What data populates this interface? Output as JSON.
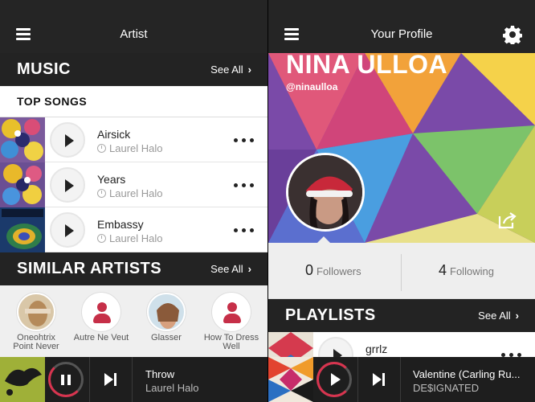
{
  "left_screen": {
    "header_title": "Artist",
    "music": {
      "title": "MUSIC",
      "see_all": "See All"
    },
    "top_songs_label": "TOP SONGS",
    "songs": [
      {
        "title": "Airsick",
        "artist": "Laurel Halo"
      },
      {
        "title": "Years",
        "artist": "Laurel Halo"
      },
      {
        "title": "Embassy",
        "artist": "Laurel Halo"
      }
    ],
    "similar": {
      "title": "SIMILAR ARTISTS",
      "see_all": "See All",
      "artists": [
        {
          "name_line1": "Oneohtrix",
          "name_line2": "Point Never"
        },
        {
          "name_line1": "Autre Ne Veut",
          "name_line2": ""
        },
        {
          "name_line1": "Glasser",
          "name_line2": ""
        },
        {
          "name_line1": "How To Dress",
          "name_line2": "Well"
        }
      ]
    },
    "player": {
      "title": "Throw",
      "artist": "Laurel Halo",
      "progress_fraction": 0.35
    }
  },
  "right_screen": {
    "header_title": "Your Profile",
    "profile_name": "NINA ULLOA",
    "handle": "@ninaulloa",
    "followers": {
      "count": "0",
      "label": "Followers"
    },
    "following": {
      "count": "4",
      "label": "Following"
    },
    "playlists": {
      "title": "PLAYLISTS",
      "see_all": "See All"
    },
    "playlist_items": [
      {
        "title": "grrlz"
      }
    ],
    "player": {
      "title": "Valentine (Carling Ru...",
      "artist": "DE$IGNATED",
      "progress_fraction": 0.6
    }
  },
  "colors": {
    "accent": "#d8344f",
    "bar": "#232323"
  },
  "icons": [
    "menu-icon",
    "chevron-right-icon",
    "play-icon",
    "clock-icon",
    "more-icon",
    "pause-icon",
    "skip-next-icon",
    "gear-icon",
    "share-icon"
  ]
}
